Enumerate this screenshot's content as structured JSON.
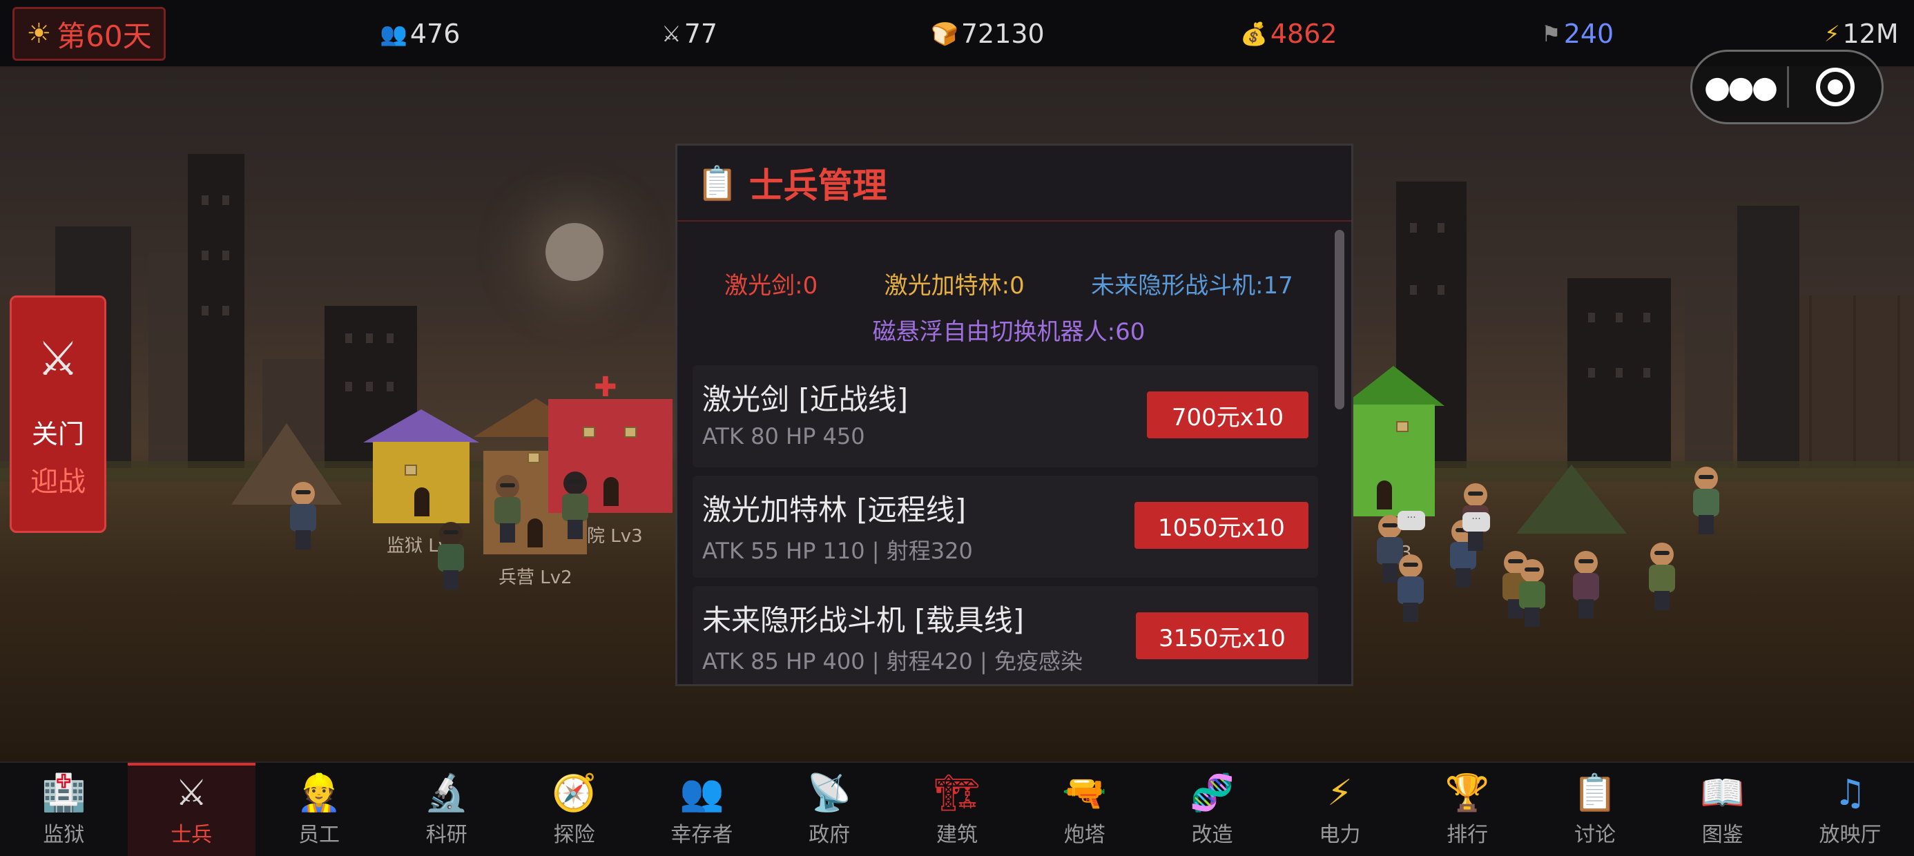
{
  "topbar": {
    "day": "第60天",
    "stats": [
      {
        "key": "population",
        "icon": "people-icon",
        "value": "476",
        "color": "#dcdcdc"
      },
      {
        "key": "soldiers",
        "icon": "crossed-swords-icon",
        "value": "77",
        "color": "#dcdcdc"
      },
      {
        "key": "food",
        "icon": "bread-icon",
        "value": "72130",
        "color": "#dcdcdc"
      },
      {
        "key": "money",
        "icon": "money-bag-icon",
        "value": "4862",
        "color": "#e8453a"
      },
      {
        "key": "territory",
        "icon": "flag-icon",
        "value": "240",
        "color": "#6a8cff"
      },
      {
        "key": "power",
        "icon": "lightning-icon",
        "value": "12M",
        "color": "#dcdcdc"
      }
    ]
  },
  "scene": {
    "buildings": [
      {
        "label": "监狱 Lv"
      },
      {
        "label": "兵营 Lv2"
      },
      {
        "label": "院 Lv3"
      },
      {
        "label": "3"
      }
    ]
  },
  "gate_button": {
    "line1": "关门",
    "line2": "迎战"
  },
  "modal": {
    "title": "士兵管理",
    "inventory": [
      {
        "label": "激光剑:0",
        "color": "#e8453a"
      },
      {
        "label": "激光加特林:0",
        "color": "#e8b040"
      },
      {
        "label": "未来隐形战斗机:17",
        "color": "#5a9ad8"
      },
      {
        "label": "磁悬浮自由切换机器人:60",
        "color": "#a070e0"
      }
    ],
    "units": [
      {
        "name": "激光剑 [近战线]",
        "stats": "ATK 80 HP 450",
        "price": "700元x10"
      },
      {
        "name": "激光加特林 [远程线]",
        "stats": "ATK 55 HP 110 | 射程320",
        "price": "1050元x10"
      },
      {
        "name": "未来隐形战斗机 [载具线]",
        "stats": "ATK 85 HP 400 | 射程420 | 免疫感染",
        "price": "3150元x10"
      }
    ]
  },
  "nav": [
    {
      "label": "监狱",
      "icon": "hospital-icon",
      "active": false
    },
    {
      "label": "士兵",
      "icon": "crossed-swords-icon",
      "active": true
    },
    {
      "label": "员工",
      "icon": "worker-icon",
      "active": false
    },
    {
      "label": "科研",
      "icon": "microscope-icon",
      "active": false
    },
    {
      "label": "探险",
      "icon": "compass-icon",
      "active": false
    },
    {
      "label": "幸存者",
      "icon": "people-icon",
      "active": false
    },
    {
      "label": "政府",
      "icon": "satellite-icon",
      "active": false
    },
    {
      "label": "建筑",
      "icon": "crane-icon",
      "active": false
    },
    {
      "label": "炮塔",
      "icon": "water-gun-icon",
      "active": false
    },
    {
      "label": "改造",
      "icon": "dna-icon",
      "active": false
    },
    {
      "label": "电力",
      "icon": "lightning-icon",
      "active": false
    },
    {
      "label": "排行",
      "icon": "trophy-icon",
      "active": false
    },
    {
      "label": "讨论",
      "icon": "clipboard-icon",
      "active": false
    },
    {
      "label": "图鉴",
      "icon": "book-icon",
      "active": false
    },
    {
      "label": "放映厅",
      "icon": "music-note-icon",
      "active": false
    }
  ]
}
